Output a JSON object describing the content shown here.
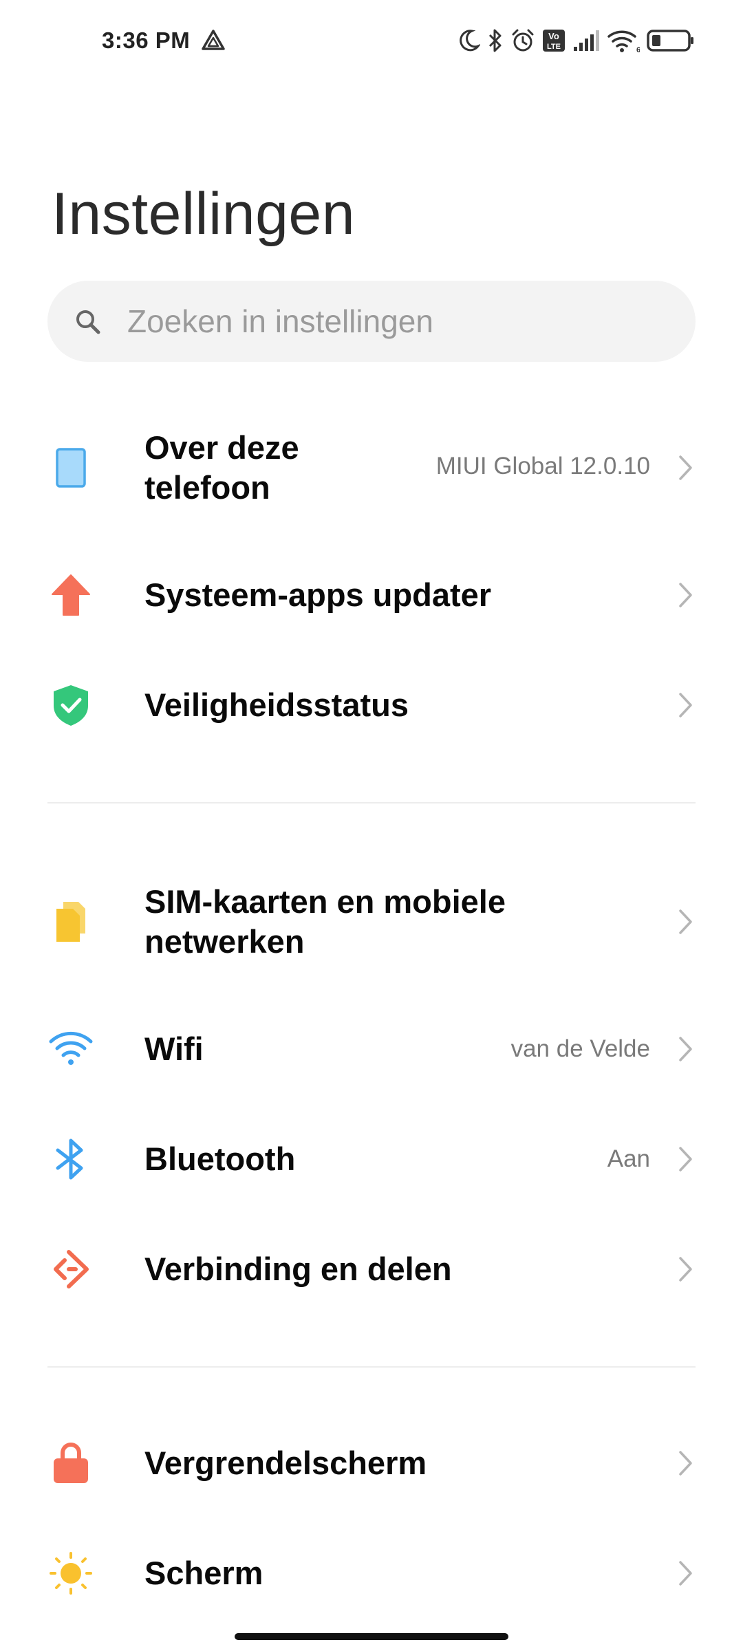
{
  "status_bar": {
    "time": "3:36 PM",
    "left_icon": "drive-triangle-icon",
    "right_icons": [
      "moon-icon",
      "bluetooth-icon",
      "alarm-icon",
      "volte-icon",
      "signal-icon",
      "wifi-icon",
      "battery-icon"
    ],
    "wifi_badge": "6",
    "volte_top": "Vo",
    "volte_bottom": "LTE"
  },
  "title": "Instellingen",
  "search": {
    "placeholder": "Zoeken in instellingen",
    "icon": "search-icon"
  },
  "sections": [
    {
      "items": [
        {
          "label": "Over deze telefoon",
          "label_line1": "Over deze",
          "label_line2": "telefoon",
          "value": "MIUI Global 12.0.10",
          "icon": "phone-icon",
          "icon_color": "#5ab4ee"
        },
        {
          "label": "Systeem-apps updater",
          "value": "",
          "icon": "arrow-up-icon",
          "icon_color": "#f57159"
        },
        {
          "label": "Veiligheidsstatus",
          "value": "",
          "icon": "shield-check-icon",
          "icon_color": "#2ecc71"
        }
      ]
    },
    {
      "items": [
        {
          "label": "SIM-kaarten en mobiele netwerken",
          "label_line1": "SIM-kaarten en mobiele",
          "label_line2": "netwerken",
          "value": "",
          "icon": "sim-card-icon",
          "icon_color": "#f7c531"
        },
        {
          "label": "Wifi",
          "value": "van de Velde",
          "icon": "wifi-icon",
          "icon_color": "#3fa2f0"
        },
        {
          "label": "Bluetooth",
          "value": "Aan",
          "icon": "bluetooth-icon",
          "icon_color": "#3fa2f0"
        },
        {
          "label": "Verbinding en delen",
          "value": "",
          "icon": "connection-share-icon",
          "icon_color": "#f26c4f"
        }
      ]
    },
    {
      "items": [
        {
          "label": "Vergrendelscherm",
          "value": "",
          "icon": "lock-icon",
          "icon_color": "#f57159"
        },
        {
          "label": "Scherm",
          "value": "",
          "icon": "sun-icon",
          "icon_color": "#f9c12e"
        }
      ]
    }
  ]
}
